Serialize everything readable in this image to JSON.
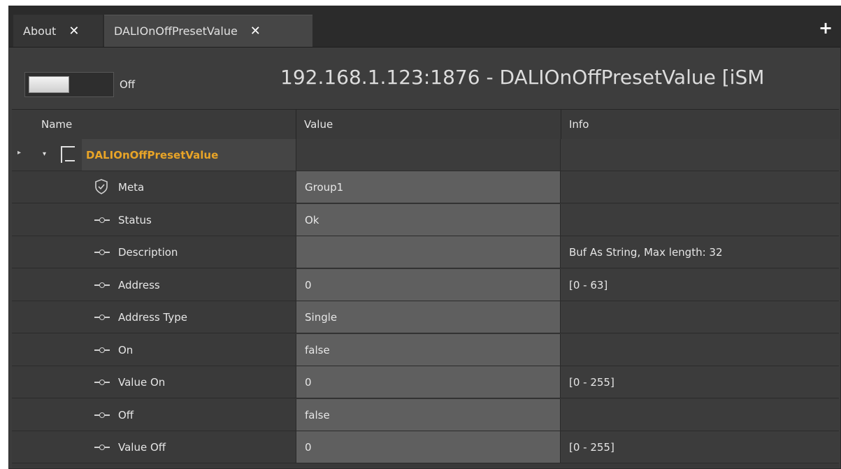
{
  "tabs": [
    {
      "label": "About",
      "close": "✕"
    },
    {
      "label": "DALIOnOffPresetValue",
      "close": "✕"
    }
  ],
  "add_tab_icon": "+",
  "header": {
    "toggle_state": "Off",
    "title": "192.168.1.123:1876 - DALIOnOffPresetValue [iSM"
  },
  "grid": {
    "columns": [
      "Name",
      "Value",
      "Info"
    ],
    "root": {
      "name": "DALIOnOffPresetValue",
      "expander": "▸",
      "chevron": "▾"
    },
    "rows": [
      {
        "name": "Meta",
        "icon": "shield-icon",
        "value": "Group1",
        "info": ""
      },
      {
        "name": "Status",
        "icon": "pin-icon",
        "value": "Ok",
        "info": ""
      },
      {
        "name": "Description",
        "icon": "pin-icon",
        "value": "",
        "info": "Buf As String, Max length: 32"
      },
      {
        "name": "Address",
        "icon": "pin-icon",
        "value": "0",
        "info": "[0 - 63]"
      },
      {
        "name": "Address Type",
        "icon": "pin-icon",
        "value": "Single",
        "info": ""
      },
      {
        "name": "On",
        "icon": "pin-icon",
        "value": "false",
        "info": ""
      },
      {
        "name": "Value On",
        "icon": "pin-icon",
        "value": "0",
        "info": "[0 - 255]"
      },
      {
        "name": "Off",
        "icon": "pin-icon",
        "value": "false",
        "info": ""
      },
      {
        "name": "Value Off",
        "icon": "pin-icon",
        "value": "0",
        "info": "[0 - 255]"
      }
    ]
  },
  "colors": {
    "root_name": "#e8a427",
    "background": "#3c3c3c",
    "value_cell": "#5f5f5f"
  }
}
